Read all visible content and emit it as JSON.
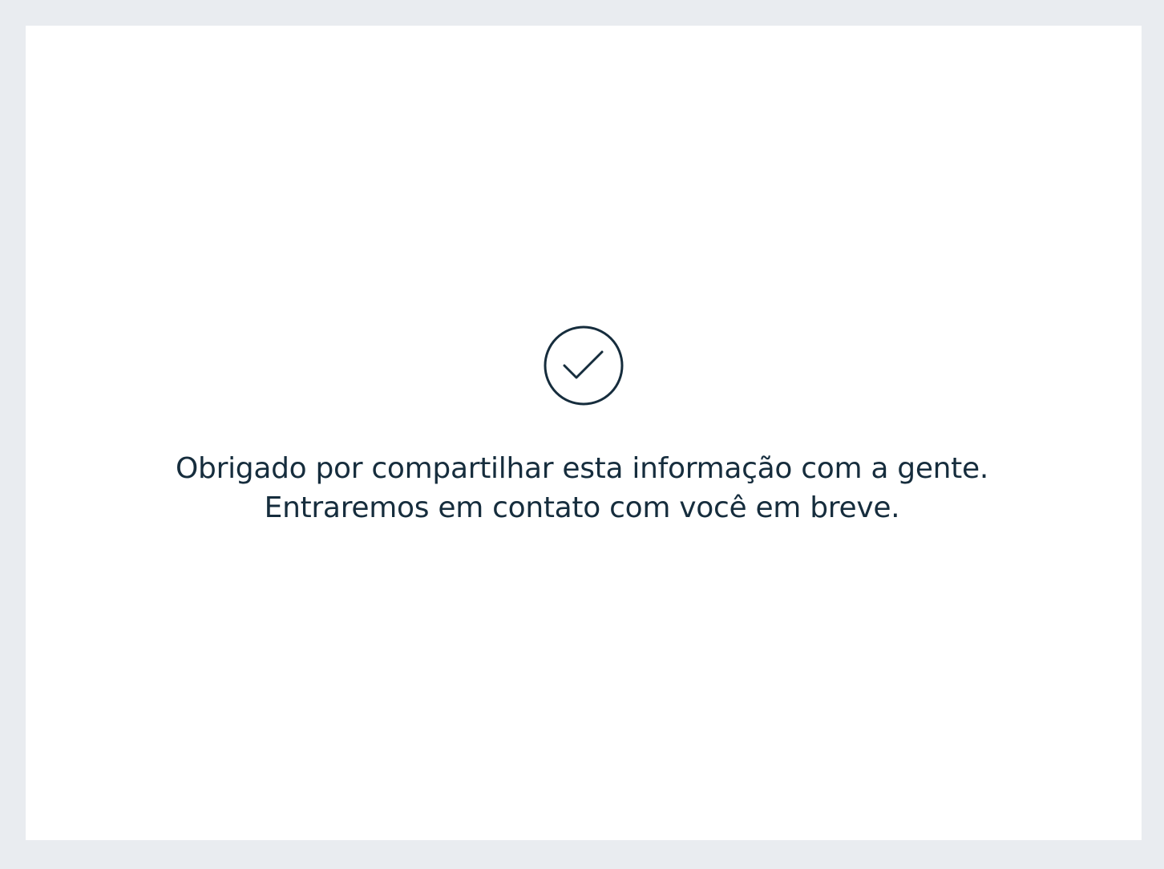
{
  "confirmation": {
    "icon": "check-circle-icon",
    "line1": "Obrigado por compartilhar esta informação com a gente.",
    "line2": "Entraremos em contato com você em breve."
  },
  "colors": {
    "background": "#e9ecf0",
    "card": "#ffffff",
    "text": "#162d3d",
    "icon": "#162d3d"
  }
}
